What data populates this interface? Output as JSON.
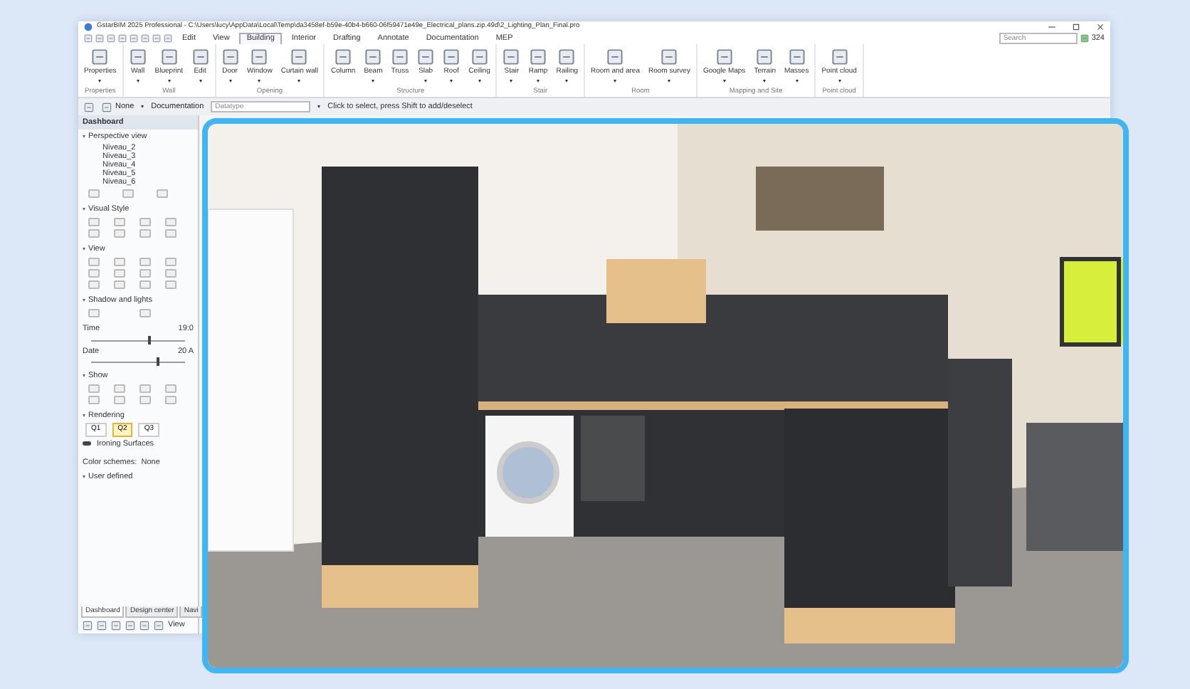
{
  "window": {
    "title": "GstarBIM 2025 Professional - C:\\Users\\lucy\\AppData\\Local\\Temp\\da3458ef-b59e-40b4-b660-06f59471e49e_Electrical_plans.zip.49d\\2_Lighting_Plan_Final.pro"
  },
  "ribbon_tabs": [
    {
      "label": "Edit",
      "selected": false
    },
    {
      "label": "View",
      "selected": false
    },
    {
      "label": "Building",
      "selected": true
    },
    {
      "label": "Interior",
      "selected": false
    },
    {
      "label": "Drafting",
      "selected": false
    },
    {
      "label": "Annotate",
      "selected": false
    },
    {
      "label": "Documentation",
      "selected": false
    },
    {
      "label": "MEP",
      "selected": false
    }
  ],
  "search": {
    "placeholder": "Search"
  },
  "counter": "324",
  "ribbon_groups": [
    {
      "label": "Properties",
      "buttons": [
        {
          "label": "Properties",
          "dropdown": true
        }
      ]
    },
    {
      "label": "Wall",
      "buttons": [
        {
          "label": "Wall",
          "dropdown": true
        },
        {
          "label": "Blueprint",
          "dropdown": true
        },
        {
          "label": "Edit",
          "dropdown": true
        }
      ]
    },
    {
      "label": "Opening",
      "buttons": [
        {
          "label": "Door",
          "dropdown": true
        },
        {
          "label": "Window",
          "dropdown": true
        },
        {
          "label": "Curtain wall",
          "dropdown": true
        }
      ]
    },
    {
      "label": "Structure",
      "buttons": [
        {
          "label": "Column",
          "dropdown": false
        },
        {
          "label": "Beam",
          "dropdown": true
        },
        {
          "label": "Truss",
          "dropdown": false
        },
        {
          "label": "Slab",
          "dropdown": true
        },
        {
          "label": "Roof",
          "dropdown": true
        },
        {
          "label": "Ceiling",
          "dropdown": true
        }
      ]
    },
    {
      "label": "Stair",
      "buttons": [
        {
          "label": "Stair",
          "dropdown": true
        },
        {
          "label": "Ramp",
          "dropdown": true
        },
        {
          "label": "Railing",
          "dropdown": true
        }
      ]
    },
    {
      "label": "Room",
      "buttons": [
        {
          "label": "Room and area",
          "dropdown": true
        },
        {
          "label": "Room survey",
          "dropdown": true
        }
      ]
    },
    {
      "label": "Mapping and Site",
      "buttons": [
        {
          "label": "Google Maps",
          "dropdown": true
        },
        {
          "label": "Terrain",
          "dropdown": true
        },
        {
          "label": "Masses",
          "dropdown": true
        }
      ]
    },
    {
      "label": "Point cloud",
      "buttons": [
        {
          "label": "Point cloud",
          "dropdown": true
        }
      ]
    }
  ],
  "toolbar": {
    "layer": "None",
    "view": "Documentation",
    "field_placeholder": "Datatype",
    "hint": "Click to select, press Shift to add/deselect"
  },
  "dashboard": {
    "title": "Dashboard",
    "sections": [
      {
        "kind": "list",
        "title": "Perspective view",
        "items": [
          "Niveau_2",
          "Niveau_3",
          "Niveau_4",
          "Niveau_5",
          "Niveau_6"
        ]
      },
      {
        "kind": "icons",
        "title": "Visual Style"
      },
      {
        "kind": "icons",
        "title": "View"
      },
      {
        "kind": "sliders",
        "title": "Shadow and lights",
        "sliders": [
          {
            "label": "Time",
            "reading": "19:0",
            "level": 0.6
          },
          {
            "label": "Date",
            "reading": "20 A",
            "level": 0.7
          }
        ]
      },
      {
        "kind": "icons",
        "title": "Show"
      },
      {
        "kind": "rendering",
        "title": "Rendering",
        "qualities": [
          {
            "label": "Q1",
            "selected": false
          },
          {
            "label": "Q2",
            "selected": true
          },
          {
            "label": "Q3",
            "selected": false
          }
        ],
        "option": {
          "label": "Ironing Surfaces",
          "on": true
        }
      }
    ],
    "color_schemes": "Color schemes:  None",
    "user_defined": "User defined",
    "bottom_tabs": [
      {
        "label": "Dashboard",
        "selected": true
      },
      {
        "label": "Design center",
        "selected": false
      },
      {
        "label": "Navi",
        "selected": false
      }
    ],
    "bottom_view": "View"
  }
}
